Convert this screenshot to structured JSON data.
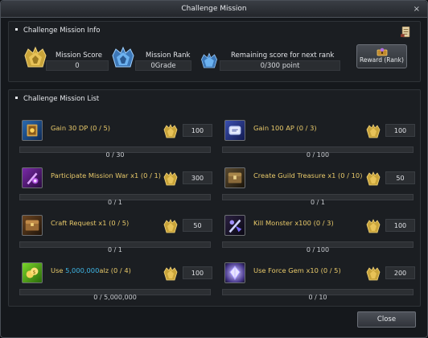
{
  "window": {
    "title": "Challenge Mission",
    "close_glyph": "×"
  },
  "info": {
    "section_title": "Challenge Mission Info",
    "mission_score_label": "Mission Score",
    "mission_score_value": "0",
    "mission_rank_label": "Mission Rank",
    "mission_rank_value": "0Grade",
    "remaining_label": "Remaining score for next rank",
    "remaining_value": "0/300 point",
    "reward_button": "Reward (Rank)"
  },
  "list": {
    "section_title": "Challenge Mission List",
    "missions": [
      {
        "title": "Gain 30 DP (0 / 5)",
        "points": "100",
        "progress": "0 / 30",
        "icon": "dp-book-icon"
      },
      {
        "title": "Gain 100 AP (0 / 3)",
        "points": "100",
        "progress": "0 / 100",
        "icon": "ap-scroll-icon"
      },
      {
        "title": "Participate Mission War x1 (0 / 1)",
        "points": "300",
        "progress": "0 / 1",
        "icon": "mission-war-icon"
      },
      {
        "title": "Create Guild Treasure x1 (0 / 10)",
        "points": "50",
        "progress": "0 / 1",
        "icon": "guild-treasure-icon"
      },
      {
        "title": "Craft Request x1 (0 / 5)",
        "points": "50",
        "progress": "0 / 1",
        "icon": "craft-chest-icon"
      },
      {
        "title": "Kill Monster x100 (0 / 3)",
        "points": "100",
        "progress": "0 / 100",
        "icon": "kill-monster-icon"
      },
      {
        "title_pre": "Use ",
        "title_hl": "5,000,000",
        "title_post": "alz (0 / 4)",
        "points": "100",
        "progress": "0 / 5,000,000",
        "icon": "alz-coins-icon"
      },
      {
        "title": "Use Force Gem x10 (0 / 5)",
        "points": "200",
        "progress": "0 / 10",
        "icon": "force-gem-icon"
      }
    ]
  },
  "footer": {
    "close_button": "Close"
  },
  "colors": {
    "mission_title": "#e8c96a",
    "highlight": "#3fb6e6",
    "gold": "#c9a43a",
    "blue": "#5fa6e6"
  }
}
